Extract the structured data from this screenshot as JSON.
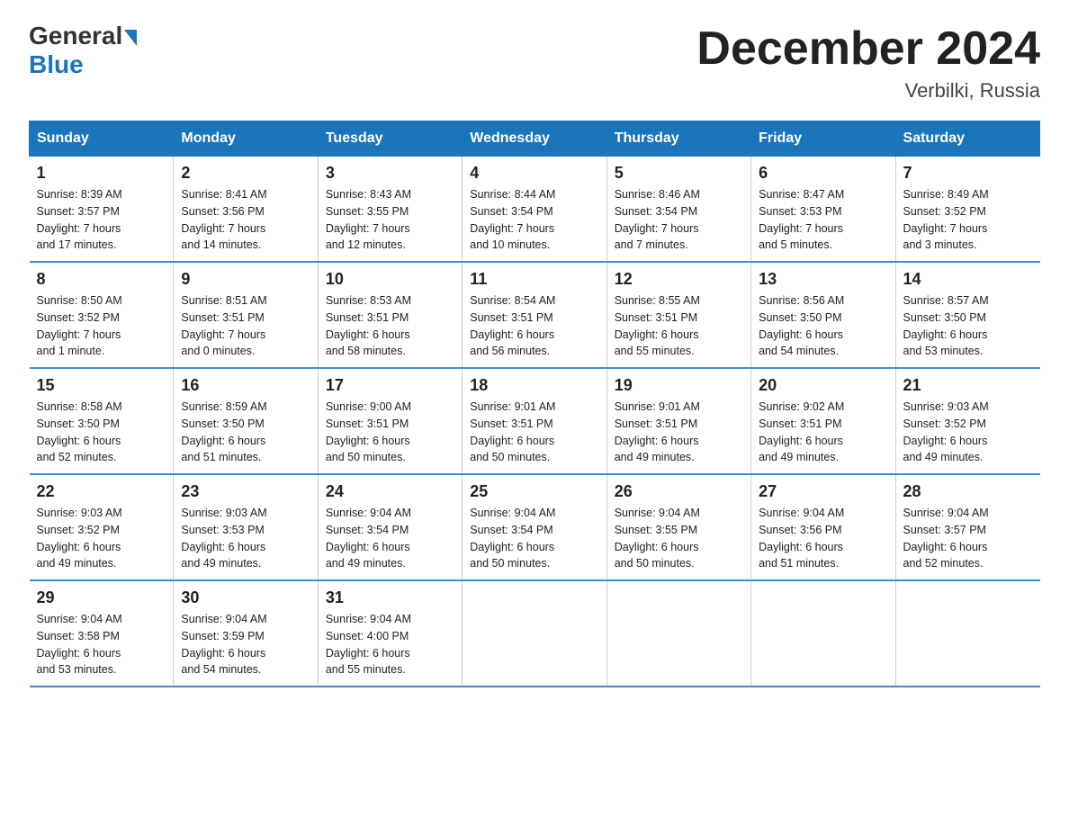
{
  "header": {
    "logo_general": "General",
    "logo_blue": "Blue",
    "title": "December 2024",
    "subtitle": "Verbilki, Russia"
  },
  "days_of_week": [
    "Sunday",
    "Monday",
    "Tuesday",
    "Wednesday",
    "Thursday",
    "Friday",
    "Saturday"
  ],
  "weeks": [
    [
      {
        "day": "1",
        "info": "Sunrise: 8:39 AM\nSunset: 3:57 PM\nDaylight: 7 hours\nand 17 minutes."
      },
      {
        "day": "2",
        "info": "Sunrise: 8:41 AM\nSunset: 3:56 PM\nDaylight: 7 hours\nand 14 minutes."
      },
      {
        "day": "3",
        "info": "Sunrise: 8:43 AM\nSunset: 3:55 PM\nDaylight: 7 hours\nand 12 minutes."
      },
      {
        "day": "4",
        "info": "Sunrise: 8:44 AM\nSunset: 3:54 PM\nDaylight: 7 hours\nand 10 minutes."
      },
      {
        "day": "5",
        "info": "Sunrise: 8:46 AM\nSunset: 3:54 PM\nDaylight: 7 hours\nand 7 minutes."
      },
      {
        "day": "6",
        "info": "Sunrise: 8:47 AM\nSunset: 3:53 PM\nDaylight: 7 hours\nand 5 minutes."
      },
      {
        "day": "7",
        "info": "Sunrise: 8:49 AM\nSunset: 3:52 PM\nDaylight: 7 hours\nand 3 minutes."
      }
    ],
    [
      {
        "day": "8",
        "info": "Sunrise: 8:50 AM\nSunset: 3:52 PM\nDaylight: 7 hours\nand 1 minute."
      },
      {
        "day": "9",
        "info": "Sunrise: 8:51 AM\nSunset: 3:51 PM\nDaylight: 7 hours\nand 0 minutes."
      },
      {
        "day": "10",
        "info": "Sunrise: 8:53 AM\nSunset: 3:51 PM\nDaylight: 6 hours\nand 58 minutes."
      },
      {
        "day": "11",
        "info": "Sunrise: 8:54 AM\nSunset: 3:51 PM\nDaylight: 6 hours\nand 56 minutes."
      },
      {
        "day": "12",
        "info": "Sunrise: 8:55 AM\nSunset: 3:51 PM\nDaylight: 6 hours\nand 55 minutes."
      },
      {
        "day": "13",
        "info": "Sunrise: 8:56 AM\nSunset: 3:50 PM\nDaylight: 6 hours\nand 54 minutes."
      },
      {
        "day": "14",
        "info": "Sunrise: 8:57 AM\nSunset: 3:50 PM\nDaylight: 6 hours\nand 53 minutes."
      }
    ],
    [
      {
        "day": "15",
        "info": "Sunrise: 8:58 AM\nSunset: 3:50 PM\nDaylight: 6 hours\nand 52 minutes."
      },
      {
        "day": "16",
        "info": "Sunrise: 8:59 AM\nSunset: 3:50 PM\nDaylight: 6 hours\nand 51 minutes."
      },
      {
        "day": "17",
        "info": "Sunrise: 9:00 AM\nSunset: 3:51 PM\nDaylight: 6 hours\nand 50 minutes."
      },
      {
        "day": "18",
        "info": "Sunrise: 9:01 AM\nSunset: 3:51 PM\nDaylight: 6 hours\nand 50 minutes."
      },
      {
        "day": "19",
        "info": "Sunrise: 9:01 AM\nSunset: 3:51 PM\nDaylight: 6 hours\nand 49 minutes."
      },
      {
        "day": "20",
        "info": "Sunrise: 9:02 AM\nSunset: 3:51 PM\nDaylight: 6 hours\nand 49 minutes."
      },
      {
        "day": "21",
        "info": "Sunrise: 9:03 AM\nSunset: 3:52 PM\nDaylight: 6 hours\nand 49 minutes."
      }
    ],
    [
      {
        "day": "22",
        "info": "Sunrise: 9:03 AM\nSunset: 3:52 PM\nDaylight: 6 hours\nand 49 minutes."
      },
      {
        "day": "23",
        "info": "Sunrise: 9:03 AM\nSunset: 3:53 PM\nDaylight: 6 hours\nand 49 minutes."
      },
      {
        "day": "24",
        "info": "Sunrise: 9:04 AM\nSunset: 3:54 PM\nDaylight: 6 hours\nand 49 minutes."
      },
      {
        "day": "25",
        "info": "Sunrise: 9:04 AM\nSunset: 3:54 PM\nDaylight: 6 hours\nand 50 minutes."
      },
      {
        "day": "26",
        "info": "Sunrise: 9:04 AM\nSunset: 3:55 PM\nDaylight: 6 hours\nand 50 minutes."
      },
      {
        "day": "27",
        "info": "Sunrise: 9:04 AM\nSunset: 3:56 PM\nDaylight: 6 hours\nand 51 minutes."
      },
      {
        "day": "28",
        "info": "Sunrise: 9:04 AM\nSunset: 3:57 PM\nDaylight: 6 hours\nand 52 minutes."
      }
    ],
    [
      {
        "day": "29",
        "info": "Sunrise: 9:04 AM\nSunset: 3:58 PM\nDaylight: 6 hours\nand 53 minutes."
      },
      {
        "day": "30",
        "info": "Sunrise: 9:04 AM\nSunset: 3:59 PM\nDaylight: 6 hours\nand 54 minutes."
      },
      {
        "day": "31",
        "info": "Sunrise: 9:04 AM\nSunset: 4:00 PM\nDaylight: 6 hours\nand 55 minutes."
      },
      {
        "day": "",
        "info": ""
      },
      {
        "day": "",
        "info": ""
      },
      {
        "day": "",
        "info": ""
      },
      {
        "day": "",
        "info": ""
      }
    ]
  ]
}
